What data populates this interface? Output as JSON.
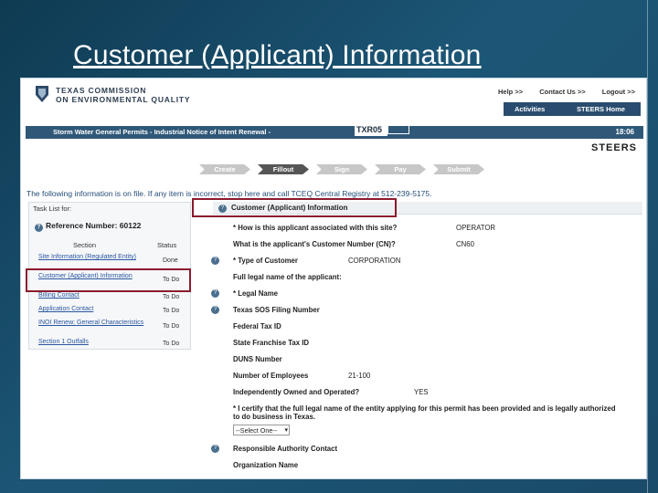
{
  "slide": {
    "title": "Customer (Applicant) Information"
  },
  "header": {
    "logo_line1": "TEXAS COMMISSION",
    "logo_line2": "ON ENVIRONMENTAL QUALITY",
    "links": [
      "Help >>",
      "Contact Us >>",
      "Logout >>"
    ],
    "tabs": [
      "Activities",
      "STEERS Home"
    ]
  },
  "titlebar": {
    "text": "Storm Water General Permits - Industrial Notice of Intent Renewal -",
    "badge": "TXR05",
    "badge2": "",
    "clock": "18:06"
  },
  "brand": "STEERS",
  "steps": [
    {
      "label": "Create",
      "active": false
    },
    {
      "label": "Fillout",
      "active": true
    },
    {
      "label": "Sign",
      "active": false
    },
    {
      "label": "Pay",
      "active": false
    },
    {
      "label": "Submit",
      "active": false
    }
  ],
  "info_line": "The following information is on file. If any item is incorrect, stop here and call TCEQ Central Registry at 512-239-5175.",
  "tasklist": {
    "title": "Task List for:",
    "reference": "Reference Number: 60122",
    "col_section": "Section",
    "col_status": "Status",
    "items": [
      {
        "label": "Site Information (Regulated Entity)",
        "status": "Done"
      },
      {
        "label": "Customer (Applicant) Information",
        "status": "To Do"
      },
      {
        "label": "Billing Contact",
        "status": "To Do"
      },
      {
        "label": "Application Contact",
        "status": "To Do"
      },
      {
        "label": "INOI Renew: General Characteristics",
        "status": "To Do"
      },
      {
        "label": "Section 1 Outfalls",
        "status": "To Do"
      }
    ]
  },
  "form": {
    "header": "Customer (Applicant) Information",
    "fields": [
      {
        "label": "* How is this applicant associated with this site?",
        "value": "OPERATOR"
      },
      {
        "label": "What is the applicant's Customer Number (CN)?",
        "value": "CN60"
      },
      {
        "label": "* Type of Customer",
        "value": "CORPORATION"
      },
      {
        "label": "Full legal name of the applicant:",
        "value": ""
      },
      {
        "label": "* Legal Name",
        "value": ""
      },
      {
        "label": "Texas SOS Filing Number",
        "value": ""
      },
      {
        "label": "Federal Tax ID",
        "value": ""
      },
      {
        "label": "State Franchise Tax ID",
        "value": ""
      },
      {
        "label": "DUNS Number",
        "value": ""
      },
      {
        "label": "Number of Employees",
        "value": "21-100"
      },
      {
        "label": "Independently Owned and Operated?",
        "value": "YES"
      }
    ],
    "certify": "* I certify that the full legal name of the entity applying for this permit has been provided and is legally authorized to do business in Texas.",
    "select_value": "--Select One--",
    "section2": "Responsible Authority Contact",
    "org_label": "Organization Name"
  }
}
